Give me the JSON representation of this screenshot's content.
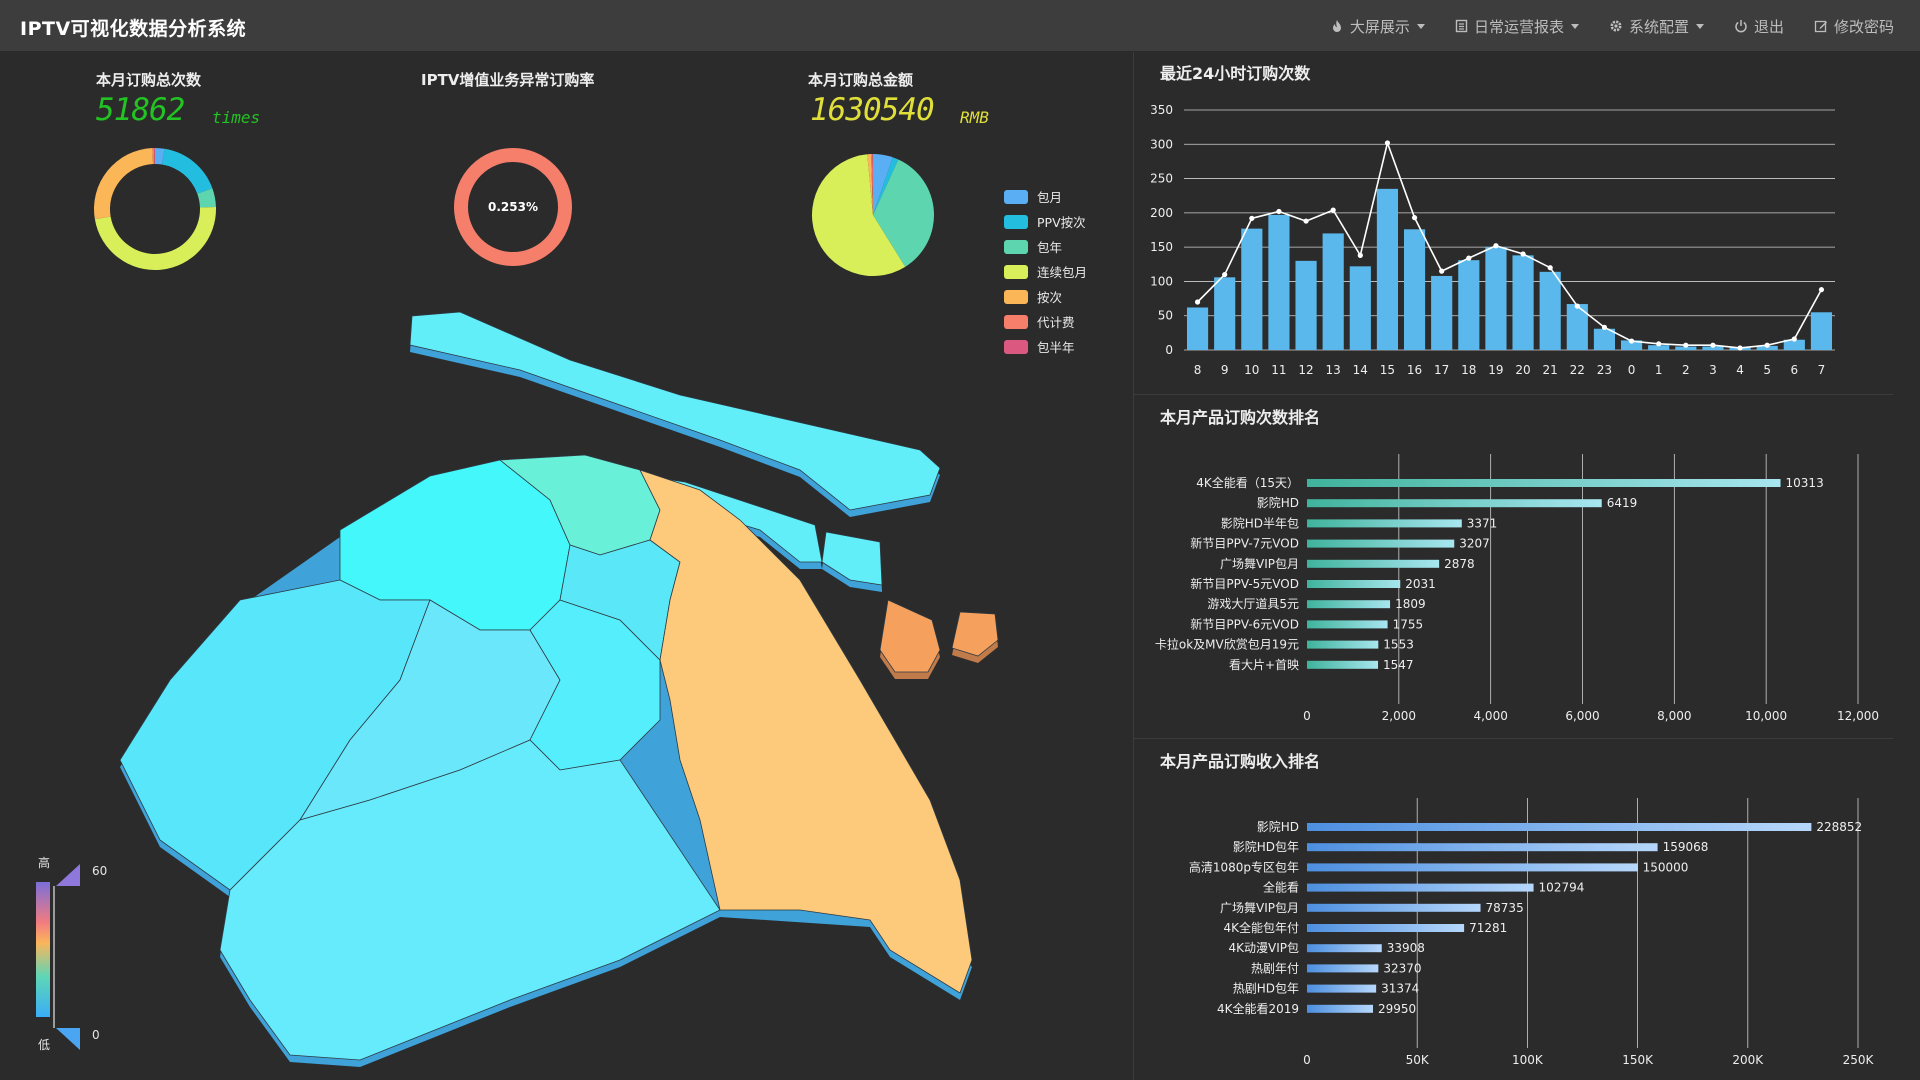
{
  "app": {
    "title": "IPTV可视化数据分析系统",
    "nav": [
      {
        "label": "大屏展示",
        "icon": "fire-icon",
        "dropdown": true
      },
      {
        "label": "日常运营报表",
        "icon": "report-icon",
        "dropdown": true
      },
      {
        "label": "系统配置",
        "icon": "gear-icon",
        "dropdown": true
      },
      {
        "label": "退出",
        "icon": "power-icon",
        "dropdown": false
      },
      {
        "label": "修改密码",
        "icon": "edit-icon",
        "dropdown": false
      }
    ]
  },
  "kpis": {
    "orders": {
      "title": "本月订购总次数",
      "value": "51862",
      "unit": "times",
      "color": "#22c322"
    },
    "abnormal": {
      "title": "IPTV增值业务异常订购率",
      "value": "0.253%"
    },
    "amount": {
      "title": "本月订购总金额",
      "value": "1630540",
      "unit": "RMB",
      "color": "#e0df3a"
    }
  },
  "visual_map": {
    "high_label": "高",
    "low_label": "低",
    "max": "60",
    "min": "0"
  },
  "panels": {
    "hourly": {
      "title": "最近24小时订购次数"
    },
    "count_rank": {
      "title": "本月产品订购次数排名"
    },
    "revenue_rank": {
      "title": "本月产品订购收入排名"
    }
  },
  "chart_data": [
    {
      "id": "donut",
      "type": "pie",
      "variant": "donut",
      "categories": [
        "包月",
        "PPV按次",
        "包年",
        "连续包月",
        "按次",
        "代计费",
        "包半年"
      ],
      "colors": [
        "#5aaef4",
        "#23bedf",
        "#5dd6b0",
        "#d8ef5a",
        "#fbb658",
        "#f67f6c",
        "#db5980"
      ],
      "values": [
        1300,
        8800,
        2600,
        24800,
        14000,
        230,
        132
      ]
    },
    {
      "id": "gauge",
      "type": "pie",
      "variant": "ring",
      "values": [
        0.253
      ],
      "label": "0.253%",
      "color": "#f67f6c"
    },
    {
      "id": "amount-pie",
      "type": "pie",
      "categories": [
        "包月",
        "PPV按次",
        "包年",
        "连续包月",
        "按次",
        "代计费",
        "包半年"
      ],
      "colors": [
        "#5aaef4",
        "#23bedf",
        "#5dd6b0",
        "#d8ef5a",
        "#fbb658",
        "#f67f6c",
        "#db5980"
      ],
      "values": [
        86000,
        25000,
        560000,
        935000,
        16000,
        5500,
        3040
      ],
      "legend": "right"
    },
    {
      "id": "hourly",
      "type": "bar",
      "categories": [
        "8",
        "9",
        "10",
        "11",
        "12",
        "13",
        "14",
        "15",
        "16",
        "17",
        "18",
        "19",
        "20",
        "21",
        "22",
        "23",
        "0",
        "1",
        "2",
        "3",
        "4",
        "5",
        "6",
        "7"
      ],
      "bar_values": [
        62,
        106,
        177,
        197,
        130,
        170,
        122,
        235,
        176,
        108,
        131,
        150,
        138,
        114,
        67,
        31,
        14,
        7,
        5,
        5,
        4,
        6,
        15,
        55
      ],
      "line_values": [
        70,
        110,
        192,
        202,
        188,
        204,
        138,
        302,
        193,
        115,
        134,
        152,
        140,
        120,
        64,
        33,
        13,
        9,
        7,
        7,
        3,
        7,
        16,
        88
      ],
      "ylim": [
        0,
        350
      ],
      "yticks": [
        0,
        50,
        100,
        150,
        200,
        250,
        300,
        350
      ],
      "bar_color": "#5bb8ec",
      "line_color": "#ffffff",
      "grid": true
    },
    {
      "id": "count-rank",
      "type": "bar",
      "orientation": "horizontal",
      "categories": [
        "4K全能看（15天）",
        "影院HD",
        "影院HD半年包",
        "新节目PPV-7元VOD",
        "广场舞VIP包月",
        "新节目PPV-5元VOD",
        "游戏大厅道具5元",
        "新节目PPV-6元VOD",
        "卡拉ok及MV欣赏包月19元",
        "看大片+首映"
      ],
      "values": [
        10313,
        6419,
        3371,
        3207,
        2878,
        2031,
        1809,
        1755,
        1553,
        1547
      ],
      "xlim": [
        0,
        12000
      ],
      "xticks": [
        "0",
        "2,000",
        "4,000",
        "6,000",
        "8,000",
        "10,000",
        "12,000"
      ],
      "grid": true
    },
    {
      "id": "revenue-rank",
      "type": "bar",
      "orientation": "horizontal",
      "categories": [
        "影院HD",
        "影院HD包年",
        "高清1080p专区包年",
        "全能看",
        "广场舞VIP包月",
        "4K全能包年付",
        "4K动漫VIP包",
        "热剧年付",
        "热剧HD包年",
        "4K全能看2019"
      ],
      "values": [
        228852,
        159068,
        150000,
        102794,
        78735,
        71281,
        33908,
        32370,
        31374,
        29950
      ],
      "xlim": [
        0,
        250000
      ],
      "xticks": [
        "0",
        "50K",
        "100K",
        "150K",
        "200K",
        "250K"
      ],
      "grid": true
    }
  ]
}
